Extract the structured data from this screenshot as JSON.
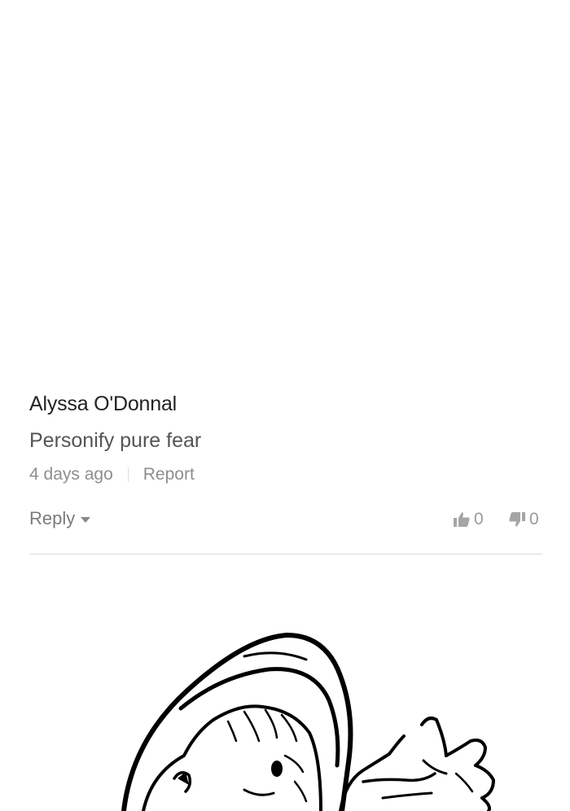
{
  "comment": {
    "author": "Alyssa O'Donnal",
    "text": "Personify pure fear",
    "timestamp": "4 days ago",
    "report_label": "Report",
    "reply_label": "Reply",
    "upvote_icon": "thumbs-up-icon",
    "downvote_icon": "thumbs-down-icon",
    "upvotes": "0",
    "downvotes": "0"
  },
  "colors": {
    "author": "#222222",
    "body": "#555555",
    "meta": "#8e8e8e",
    "divider": "#dcdcdc"
  },
  "artwork": {
    "description_icon": "comic-hooded-figure-illustration"
  }
}
